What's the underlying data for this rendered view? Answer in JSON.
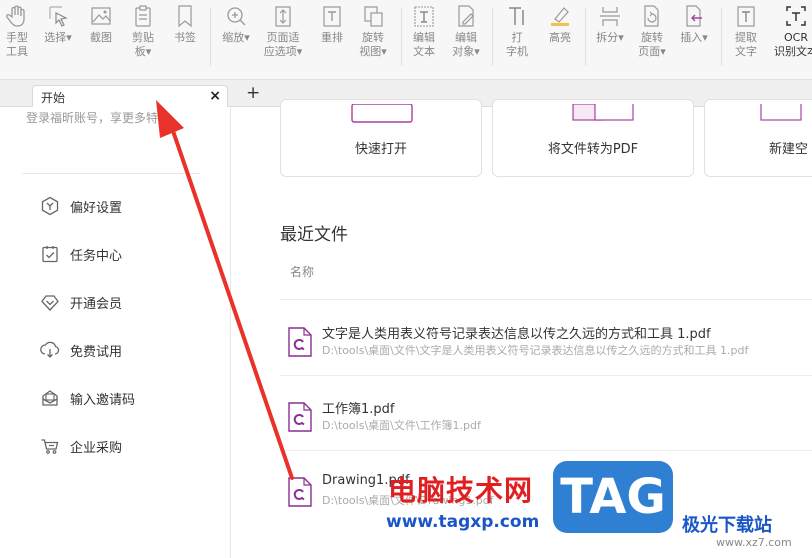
{
  "toolbar": {
    "tools": [
      {
        "label": "手型\n工具",
        "icon": "hand-icon"
      },
      {
        "label": "选择▾",
        "icon": "select-cursor-icon"
      },
      {
        "label": "截图",
        "icon": "screenshot-icon"
      },
      {
        "label": "剪贴\n板▾",
        "icon": "clipboard-icon"
      },
      {
        "label": "书签",
        "icon": "bookmark-icon"
      },
      {
        "label": "缩放▾",
        "icon": "zoom-icon"
      },
      {
        "label": "页面适\n应选项▾",
        "icon": "fit-page-icon"
      },
      {
        "label": "重排",
        "icon": "reflow-icon"
      },
      {
        "label": "旋转\n视图▾",
        "icon": "rotate-view-icon"
      },
      {
        "label": "编辑\n文本",
        "icon": "edit-text-icon"
      },
      {
        "label": "编辑\n对象▾",
        "icon": "edit-object-icon"
      },
      {
        "label": "打\n字机",
        "icon": "typewriter-icon"
      },
      {
        "label": "高亮",
        "icon": "highlight-icon"
      },
      {
        "label": "拆分▾",
        "icon": "split-icon"
      },
      {
        "label": "旋转\n页面▾",
        "icon": "rotate-page-icon"
      },
      {
        "label": "插入▾",
        "icon": "insert-icon"
      },
      {
        "label": "提取\n文字",
        "icon": "extract-text-icon"
      },
      {
        "label": "OCR\n识别文本",
        "icon": "ocr-icon"
      }
    ]
  },
  "tabs": {
    "active_label": "开始",
    "close_symbol": "×",
    "add_symbol": "+"
  },
  "sidebar": {
    "login_text": "登录福昕账号，享更多特权",
    "items": [
      {
        "label": "偏好设置",
        "icon": "preferences-icon"
      },
      {
        "label": "任务中心",
        "icon": "task-center-icon"
      },
      {
        "label": "开通会员",
        "icon": "membership-icon"
      },
      {
        "label": "免费试用",
        "icon": "free-trial-icon"
      },
      {
        "label": "输入邀请码",
        "icon": "invite-code-icon"
      },
      {
        "label": "企业采购",
        "icon": "enterprise-purchase-icon"
      }
    ]
  },
  "main": {
    "cards": [
      {
        "label": "快速打开"
      },
      {
        "label": "将文件转为PDF"
      },
      {
        "label": "新建空"
      }
    ],
    "recent_title": "最近文件",
    "column_name": "名称",
    "files": [
      {
        "name": "文字是人类用表义符号记录表达信息以传之久远的方式和工具 1.pdf",
        "path": "D:\\tools\\桌面\\文件\\文字是人类用表义符号记录表达信息以传之久远的方式和工具 1.pdf"
      },
      {
        "name": "工作簿1.pdf",
        "path": "D:\\tools\\桌面\\文件\\工作簿1.pdf"
      },
      {
        "name": "Drawing1.pdf",
        "path": "D:\\tools\\桌面\\文件\\Drawing1.pdf"
      }
    ]
  },
  "watermark": {
    "title": "电脑技术网",
    "url": "www.tagxp.com",
    "badge": "TAG",
    "brand": "极光下载站",
    "site": "www.xz7.com"
  },
  "colors": {
    "annotation_arrow": "#e8322a",
    "pdf_icon": "#8a2f93",
    "card_accent": "#a8429e"
  }
}
